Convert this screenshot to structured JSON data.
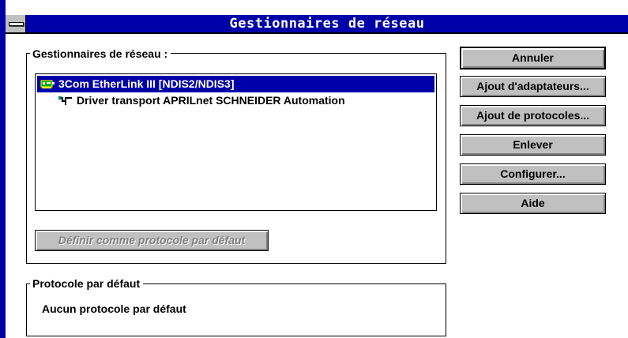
{
  "window": {
    "title": "Gestionnaires de réseau"
  },
  "drivers_group": {
    "label": "Gestionnaires de réseau :",
    "items": [
      {
        "label": "3Com EtherLink III [NDIS2/NDIS3]",
        "icon": "network-adapter-icon",
        "selected": true
      },
      {
        "label": "Driver transport APRILnet SCHNEIDER Automation",
        "icon": "protocol-icon",
        "selected": false
      }
    ],
    "set_default_button": "Définir comme protocole par défaut"
  },
  "default_group": {
    "label": "Protocole par défaut",
    "value": "Aucun protocole par défaut"
  },
  "buttons": {
    "cancel": "Annuler",
    "add_adapter": "Ajout d'adaptateurs...",
    "add_protocol": "Ajout de protocoles...",
    "remove": "Enlever",
    "configure": "Configurer...",
    "help": "Aide"
  },
  "colors": {
    "title_bar": "#0000a8",
    "button_face": "#c0c0c0",
    "selection": "#0000a8"
  }
}
